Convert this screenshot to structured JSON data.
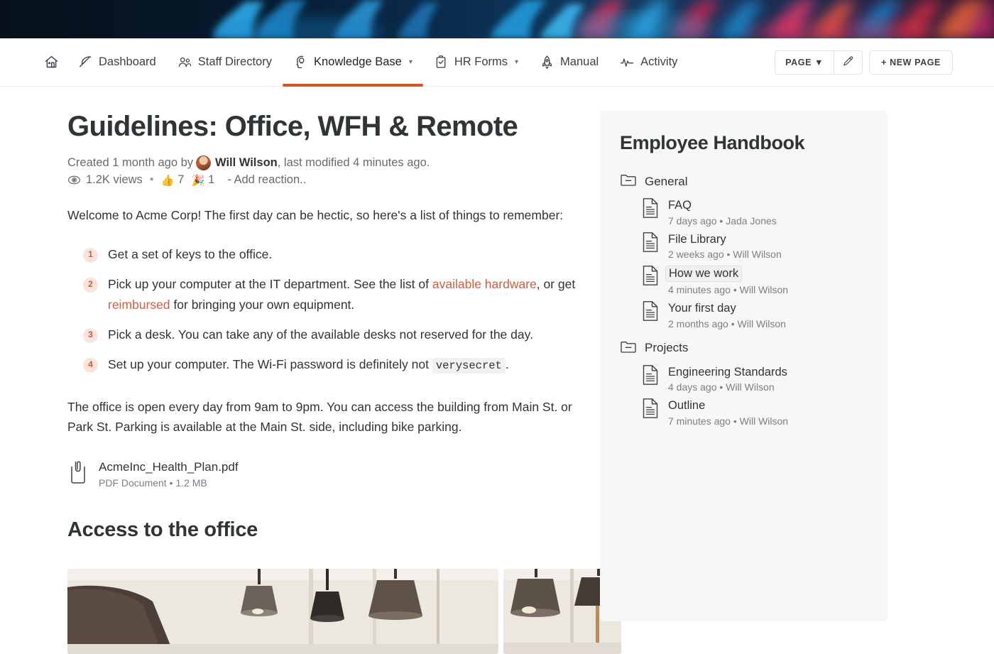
{
  "banner": {
    "alt": "abstract-ink-banner",
    "colors": [
      "#07141f",
      "#0b3a63",
      "#1f7fc4",
      "#2aa3e0",
      "#d6315a",
      "#e0553f",
      "#b5286b"
    ]
  },
  "nav": {
    "items": [
      {
        "label": "",
        "icon": "home-icon",
        "name": "home",
        "active": false,
        "caret": false
      },
      {
        "label": "Dashboard",
        "icon": "feather-icon",
        "name": "dashboard",
        "active": false,
        "caret": false
      },
      {
        "label": "Staff Directory",
        "icon": "people-icon",
        "name": "staff-directory",
        "active": false,
        "caret": false
      },
      {
        "label": "Knowledge Base",
        "icon": "head-bulb-icon",
        "name": "knowledge-base",
        "active": true,
        "caret": true
      },
      {
        "label": "HR Forms",
        "icon": "clipboard-check-icon",
        "name": "hr-forms",
        "active": false,
        "caret": true
      },
      {
        "label": "Manual",
        "icon": "rocket-icon",
        "name": "manual",
        "active": false,
        "caret": false
      },
      {
        "label": "Activity",
        "icon": "pulse-icon",
        "name": "activity",
        "active": false,
        "caret": false
      }
    ],
    "page_button": "PAGE ▼",
    "edit_icon": "pencil-icon",
    "new_page_button": "+ NEW PAGE",
    "active_underline_color": "#d9531e"
  },
  "document": {
    "title": "Guidelines: Office, WFH & Remote",
    "meta": {
      "created_prefix": "Created 1 month ago by",
      "author": "Will Wilson",
      "modified_suffix": ", last modified 4 minutes ago."
    },
    "stats": {
      "views": "1.2K views",
      "separator": "•",
      "reactions": [
        {
          "emoji": "👍",
          "count": "7"
        },
        {
          "emoji": "🎉",
          "count": "1"
        }
      ],
      "add_reaction": "- Add reaction.."
    },
    "intro": "Welcome to Acme Corp! The first day can be hectic, so here's a list of things to remember:",
    "steps": [
      {
        "num": "1",
        "parts": [
          {
            "t": "text",
            "v": "Get a set of keys to the office."
          }
        ]
      },
      {
        "num": "2",
        "parts": [
          {
            "t": "text",
            "v": "Pick up your computer at the IT department. See the list of "
          },
          {
            "t": "link",
            "v": "available hardware"
          },
          {
            "t": "text",
            "v": ", or get "
          },
          {
            "t": "link",
            "v": "reimbursed"
          },
          {
            "t": "text",
            "v": " for bringing your own equipment."
          }
        ]
      },
      {
        "num": "3",
        "parts": [
          {
            "t": "text",
            "v": "Pick a desk. You can take any of the available desks not reserved for the day."
          }
        ]
      },
      {
        "num": "4",
        "parts": [
          {
            "t": "text",
            "v": "Set up your computer. The Wi-Fi password is definitely not "
          },
          {
            "t": "code",
            "v": "verysecret"
          },
          {
            "t": "text",
            "v": "."
          }
        ]
      }
    ],
    "paragraph2": "The office is open every day from 9am to 9pm. You can access the building from Main St. or Park St. Parking is available at the Main St. side, including bike parking.",
    "attachment": {
      "icon": "paperclip-file-icon",
      "name": "AcmeInc_Health_Plan.pdf",
      "type": "PDF Document",
      "separator": "•",
      "size": "1.2 MB"
    },
    "section_heading": "Access to the office",
    "images": [
      {
        "alt": "pendant-lamps-photo-left"
      },
      {
        "alt": "pendant-lamps-photo-right"
      }
    ]
  },
  "sidebar": {
    "title": "Employee Handbook",
    "groups": [
      {
        "folder": "General",
        "icon": "folder-icon",
        "pages": [
          {
            "title": "FAQ",
            "time": "7 days ago",
            "separator": "•",
            "author": "Jada Jones",
            "current": false
          },
          {
            "title": "File Library",
            "time": "2 weeks ago",
            "separator": "•",
            "author": "Will Wilson",
            "current": false
          },
          {
            "title": "How we work",
            "time": "4 minutes ago",
            "separator": "•",
            "author": "Will Wilson",
            "current": true
          },
          {
            "title": "Your first day",
            "time": "2 months ago",
            "separator": "•",
            "author": "Will Wilson",
            "current": false
          }
        ]
      },
      {
        "folder": "Projects",
        "icon": "folder-icon",
        "pages": [
          {
            "title": "Engineering Standards",
            "time": "4 days ago",
            "separator": "•",
            "author": "Will Wilson",
            "current": false
          },
          {
            "title": "Outline",
            "time": "7 minutes ago",
            "separator": "•",
            "author": "Will Wilson",
            "current": false
          }
        ]
      }
    ]
  },
  "theme": {
    "accent": "#d9531e",
    "link": "#cf5f42",
    "badge_bg": "#fbe4dc",
    "badge_fg": "#cf5a34",
    "card_bg": "#f7f7f7"
  }
}
